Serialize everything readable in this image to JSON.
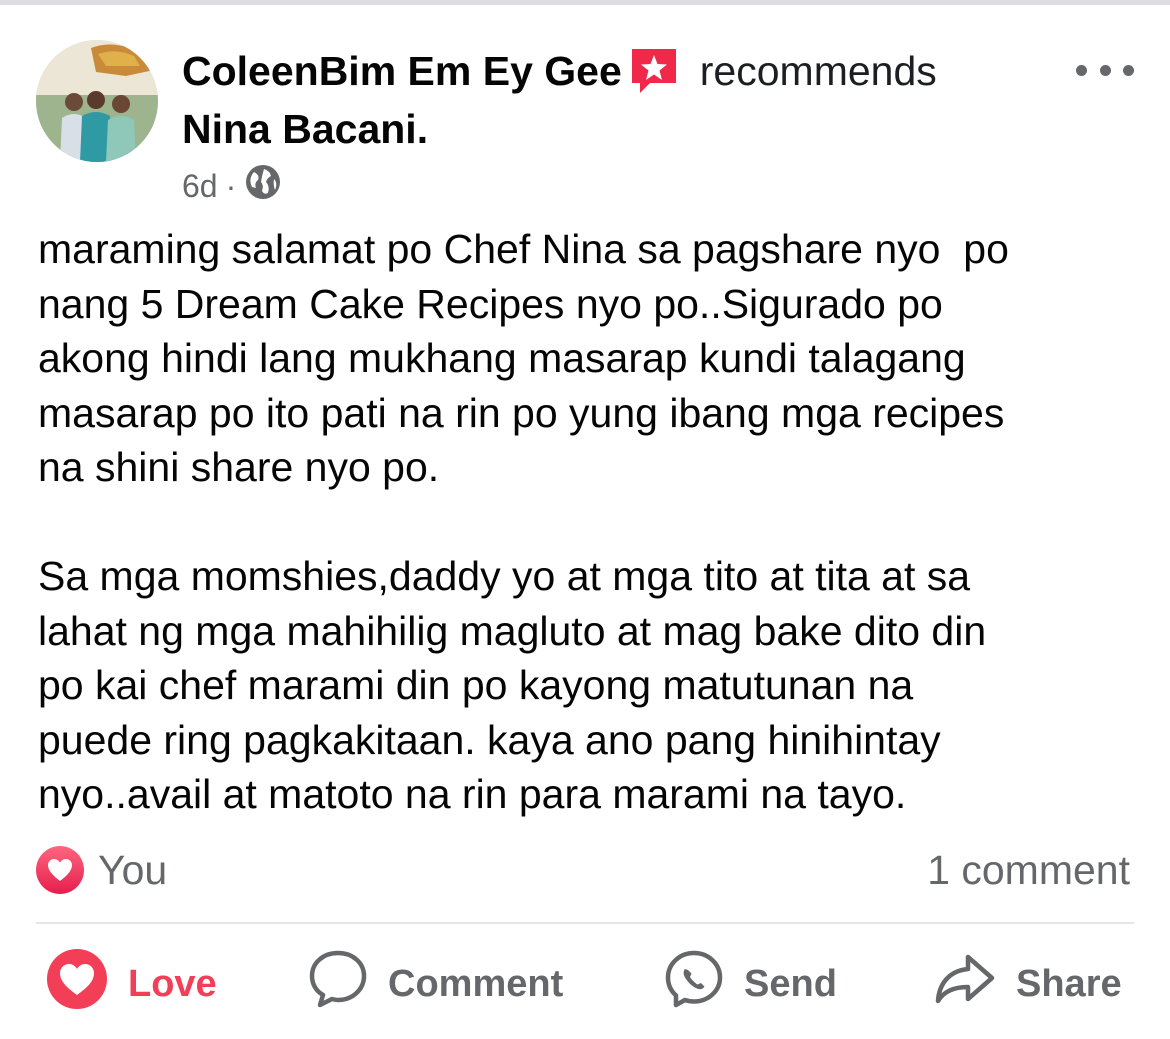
{
  "post": {
    "author": "ColeenBim Em Ey Gee",
    "action": "recommends",
    "page": "Nina Bacani.",
    "time": "6d",
    "separator": "·",
    "privacy_icon": "globe-icon",
    "badge_icon": "recommendation-star-icon",
    "text": "maraming salamat po Chef Nina sa pagshare nyo  po\nnang 5 Dream Cake Recipes nyo po..Sigurado po\nakong hindi lang mukhang masarap kundi talagang\nmasarap po ito pati na rin po yung ibang mga recipes\nna shini share nyo po.\n\nSa mga momshies,daddy yo at mga tito at tita at sa\nlahat ng mga mahihilig magluto at mag bake dito din\npo kai chef marami din po kayong matutunan na\npuede ring pagkakitaan. kaya ano pang hinihintay\nnyo..avail at matoto na rin para marami na tayo."
  },
  "reactions": {
    "reactors": "You",
    "icon": "love-reaction-icon"
  },
  "comments": {
    "count_label": "1 comment"
  },
  "actions": [
    {
      "label": "Love",
      "icon": "heart-icon"
    },
    {
      "label": "Comment",
      "icon": "comment-bubble-icon"
    },
    {
      "label": "Send",
      "icon": "messenger-icon"
    },
    {
      "label": "Share",
      "icon": "share-arrow-icon"
    }
  ],
  "colors": {
    "love": "#f33e58",
    "badge": "#f02849",
    "secondary_text": "#65676b",
    "primary_text": "#050505"
  }
}
